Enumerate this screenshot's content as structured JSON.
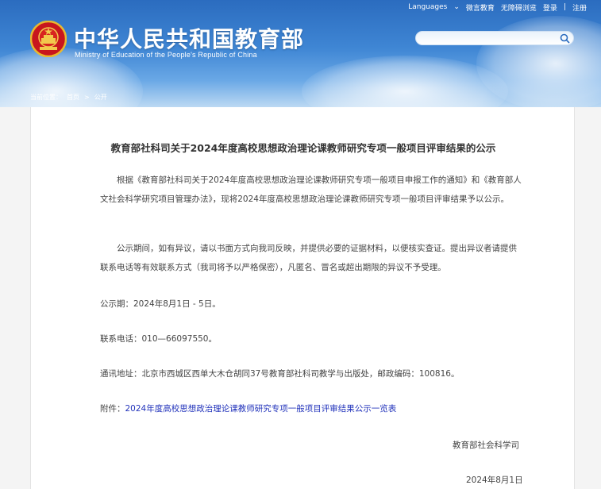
{
  "header": {
    "top_links": [
      "Languages",
      "微言教育",
      "无障碍浏览",
      "登录",
      "注册"
    ],
    "site_title": "中华人民共和国教育部",
    "site_subtitle": "Ministry of Education of the People's Republic of China",
    "search": {
      "placeholder": ""
    }
  },
  "breadcrumb": {
    "label": "当前位置：",
    "home": "首页",
    "sep": ">",
    "current": "公开"
  },
  "article": {
    "title": "教育部社科司关于2024年度高校思想政治理论课教师研究专项一般项目评审结果的公示",
    "p1": "根据《教育部社科司关于2024年度高校思想政治理论课教师研究专项一般项目申报工作的通知》和《教育部人文社会科学研究项目管理办法》，现将2024年度高校思想政治理论课教师研究专项一般项目评审结果予以公示。",
    "p2": "公示期间，如有异议，请以书面方式向我司反映，并提供必要的证据材料，以便核实查证。提出异议者请提供联系电话等有效联系方式（我司将予以严格保密），凡匿名、冒名或超出期限的异议不予受理。",
    "period": "公示期：2024年8月1日 - 5日。",
    "phone": "联系电话：010—66097550。",
    "address": "通讯地址：北京市西城区西单大木仓胡同37号教育部社科司教学与出版处，邮政编码：100816。",
    "attachment_label": "附件：",
    "attachment_link": "2024年度高校思想政治理论课教师研究专项一般项目评审结果公示一览表",
    "signature": "教育部社会科学司",
    "date": "2024年8月1日"
  },
  "colors": {
    "header_blue": "#2b6cbf",
    "link": "#2233bb",
    "text": "#444444"
  }
}
